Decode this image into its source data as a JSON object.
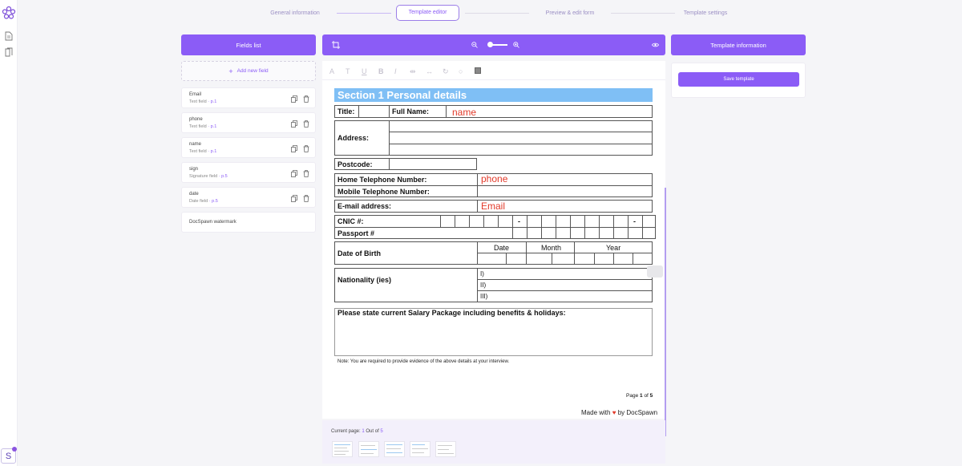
{
  "app": {
    "logo_icon": "flower-logo-icon",
    "avatar_letter": "S",
    "accent": "#8b5cf6"
  },
  "sidebar": {
    "items": [
      {
        "icon": "document-icon"
      },
      {
        "icon": "documents-icon"
      }
    ]
  },
  "stepper": {
    "steps": [
      {
        "label": "General information",
        "state": "done"
      },
      {
        "label": "Template editor",
        "state": "active"
      },
      {
        "label": "Preview & edit form",
        "state": "pending"
      },
      {
        "label": "Template settings",
        "state": "pending"
      }
    ]
  },
  "fields_panel": {
    "title": "Fields list",
    "add_label": "Add new field",
    "fields": [
      {
        "name": "Email",
        "type": "Text field",
        "page": "· p.1"
      },
      {
        "name": "phone",
        "type": "Text field",
        "page": "· p.1"
      },
      {
        "name": "name",
        "type": "Text field",
        "page": "· p.1"
      },
      {
        "name": "sign",
        "type": "Signature field",
        "page": "· p.5"
      },
      {
        "name": "date",
        "type": "Date field",
        "page": "· p.5"
      }
    ],
    "watermark_label": "DocSpawn watermark"
  },
  "editor": {
    "zoom_level": 0.5,
    "toolbar_icons": [
      "text-size-icon",
      "text-transform-icon",
      "underline-icon",
      "bold-icon",
      "italic-icon",
      "align-center-icon",
      "align-spread-icon",
      "rotate-icon",
      "lock-icon",
      "color-swatch-icon"
    ]
  },
  "document": {
    "section_title": "Section 1   Personal details",
    "title_label": "Title:",
    "full_name_label": "Full Name:",
    "name_field": "name",
    "address_label": "Address:",
    "postcode_label": "Postcode:",
    "home_tel_label": "Home Telephone Number:",
    "phone_field": "phone",
    "mobile_tel_label": "Mobile Telephone Number:",
    "email_label": "E-mail address:",
    "email_field": "Email",
    "cnic_label": "CNIC #:",
    "cnic_dash": "-",
    "passport_label": "Passport #",
    "dob_label": "Date of Birth",
    "date_col": "Date",
    "month_col": "Month",
    "year_col": "Year",
    "nationality_label": "Nationality (ies)",
    "nat_1": "I)",
    "nat_2": "II)",
    "nat_3": "III)",
    "salary_label": "Please state current Salary Package including benefits & holidays:",
    "note": "Note: You are required to provide evidence of the above details at your interview.",
    "page_prefix": "Page",
    "page_current": "1",
    "page_of": "of",
    "page_total": "5",
    "made_with_prefix": "Made with",
    "made_with_suffix": "by DocSpawn",
    "field_color": "#e23a2a",
    "header_color": "#7fbff5"
  },
  "pages": {
    "label": "Current page:",
    "current": "1",
    "out_of": "Out of",
    "total": "5"
  },
  "info_panel": {
    "title": "Template information",
    "save_label": "Save template"
  }
}
